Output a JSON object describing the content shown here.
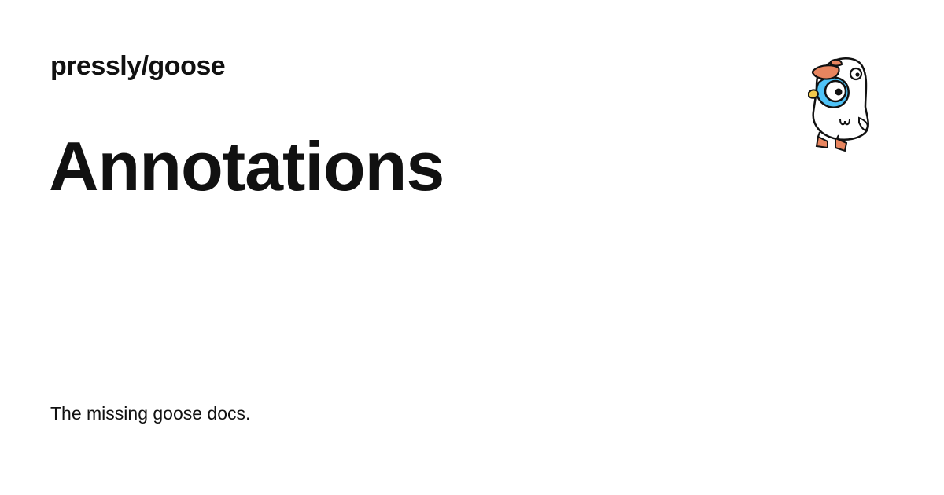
{
  "header": {
    "site_name": "pressly/goose"
  },
  "page": {
    "title": "Annotations",
    "description": "The missing goose docs."
  },
  "logo": {
    "icon": "goose-mascot-icon",
    "colors": {
      "body": "#ffffff",
      "outline": "#111111",
      "face": "#4fc3f7",
      "beak": "#f2c94c",
      "hat": "#e8855f",
      "feet": "#e8855f"
    }
  }
}
